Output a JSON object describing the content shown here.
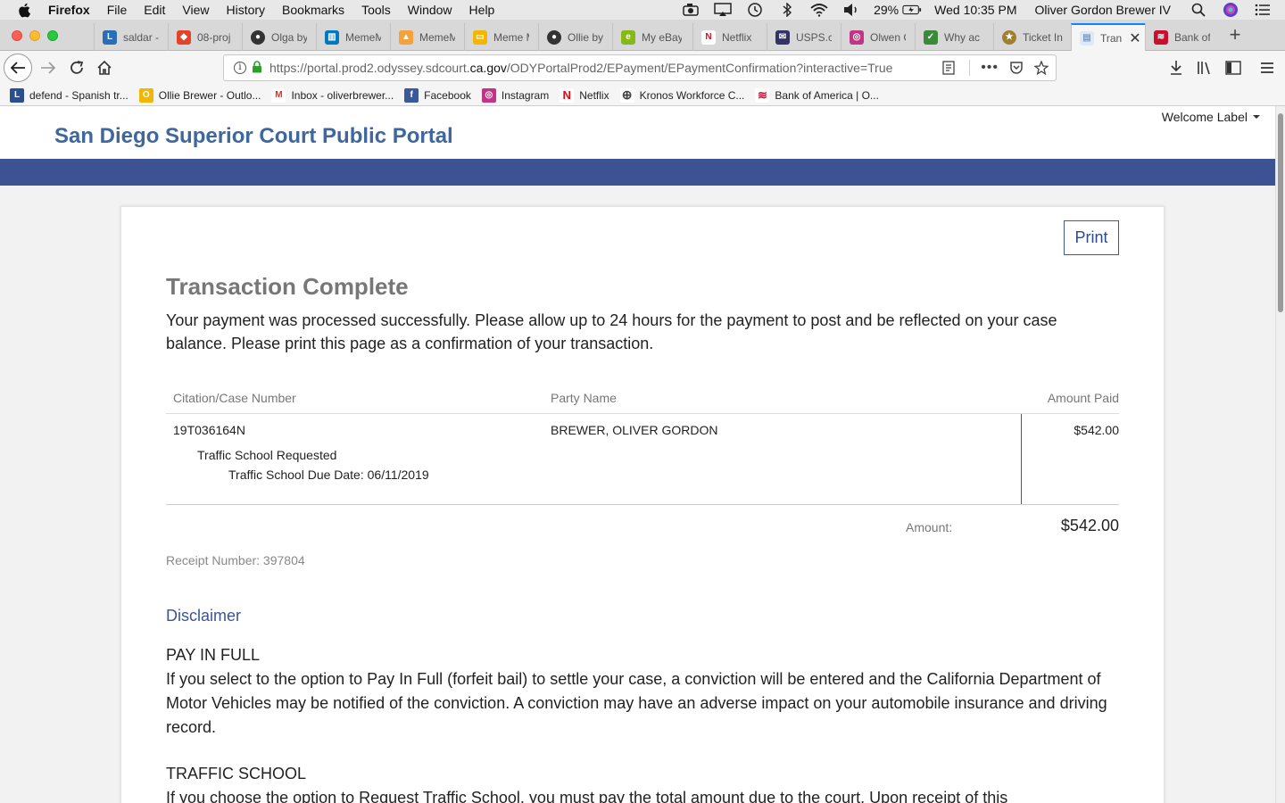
{
  "menubar": {
    "app_name": "Firefox",
    "items": [
      "File",
      "Edit",
      "View",
      "History",
      "Bookmarks",
      "Tools",
      "Window",
      "Help"
    ],
    "battery": "29%",
    "clock": "Wed 10:35 PM",
    "user": "Oliver Gordon Brewer IV"
  },
  "tabs": [
    {
      "label": "saldar -",
      "icon_color": "#2a6fb5"
    },
    {
      "label": "08-proj",
      "icon_color": "#e24329"
    },
    {
      "label": "Olga by",
      "icon_color": "#333333"
    },
    {
      "label": "MemeM",
      "icon_color": "#0079bf"
    },
    {
      "label": "MemeM",
      "icon_color": "#f4a23c"
    },
    {
      "label": "Meme M",
      "icon_color": "#f2b705"
    },
    {
      "label": "Ollie by",
      "icon_color": "#333333"
    },
    {
      "label": "My eBay",
      "icon_color": "#86b817"
    },
    {
      "label": "Netflix",
      "icon_color": "#e50914"
    },
    {
      "label": "USPS.co",
      "icon_color": "#333366"
    },
    {
      "label": "Olwen C",
      "icon_color": "#c13584"
    },
    {
      "label": "Why ac",
      "icon_color": "#3a8a3a"
    },
    {
      "label": "Ticket In",
      "icon_color": "#a08030"
    },
    {
      "label": "Tran",
      "icon_color": "#7a9cc6"
    },
    {
      "label": "Bank of",
      "icon_color": "#c8102e"
    }
  ],
  "urlbar": {
    "url_prefix": "https://portal.prod2.odyssey.sdcourt.",
    "url_domain": "ca.gov",
    "url_suffix": "/ODYPortalProd2/EPayment/EPaymentConfirmation?interactive=True"
  },
  "bookmarks": [
    {
      "label": "defend - Spanish tr...",
      "icon_color": "#2a4f8f",
      "glyph": "L"
    },
    {
      "label": "Ollie Brewer - Outlo...",
      "icon_color": "#f2b705",
      "glyph": "O"
    },
    {
      "label": "Inbox - oliverbrewer...",
      "icon_color": "#ffffff",
      "glyph": "M"
    },
    {
      "label": "Facebook",
      "icon_color": "#3b5998",
      "glyph": "f"
    },
    {
      "label": "Instagram",
      "icon_color": "#c13584",
      "glyph": "◎"
    },
    {
      "label": "Netflix",
      "icon_color": "#ffffff",
      "glyph": "N"
    },
    {
      "label": "Kronos Workforce C...",
      "icon_color": "#ffffff",
      "glyph": "⊕"
    },
    {
      "label": "Bank of America | O...",
      "icon_color": "#ffffff",
      "glyph": "≋"
    }
  ],
  "site": {
    "title": "San Diego Superior Court Public Portal",
    "welcome": "Welcome Label"
  },
  "confirmation": {
    "print_label": "Print",
    "title": "Transaction Complete",
    "message": "Your payment was processed successfully. Please allow up to 24 hours for the payment to post and be reflected on your case balance. Please print this page as a confirmation of your transaction.",
    "columns": [
      "Citation/Case Number",
      "Party Name",
      "Amount Paid"
    ],
    "row": {
      "case_number": "19T036164N",
      "school_status": "Traffic School Requested",
      "due_date": "Traffic School Due Date: 06/11/2019",
      "party": "BREWER, OLIVER GORDON",
      "amount": "$542.00"
    },
    "total_label": "Amount:",
    "total_value": "$542.00",
    "receipt": "Receipt Number: 397804"
  },
  "disclaimer": {
    "title": "Disclaimer",
    "pay_heading": "PAY IN FULL",
    "pay_text": "If you select to the option to Pay In Full (forfeit bail) to settle your case, a conviction will be entered and the California Department of Motor Vehicles may be notified of the conviction. A conviction may have an adverse impact on your automobile insurance and driving record.",
    "school_heading": "TRAFFIC SCHOOL",
    "school_text": "If you choose the option to Request Traffic School, you must pay the total amount due to the court. Upon receipt of this"
  }
}
